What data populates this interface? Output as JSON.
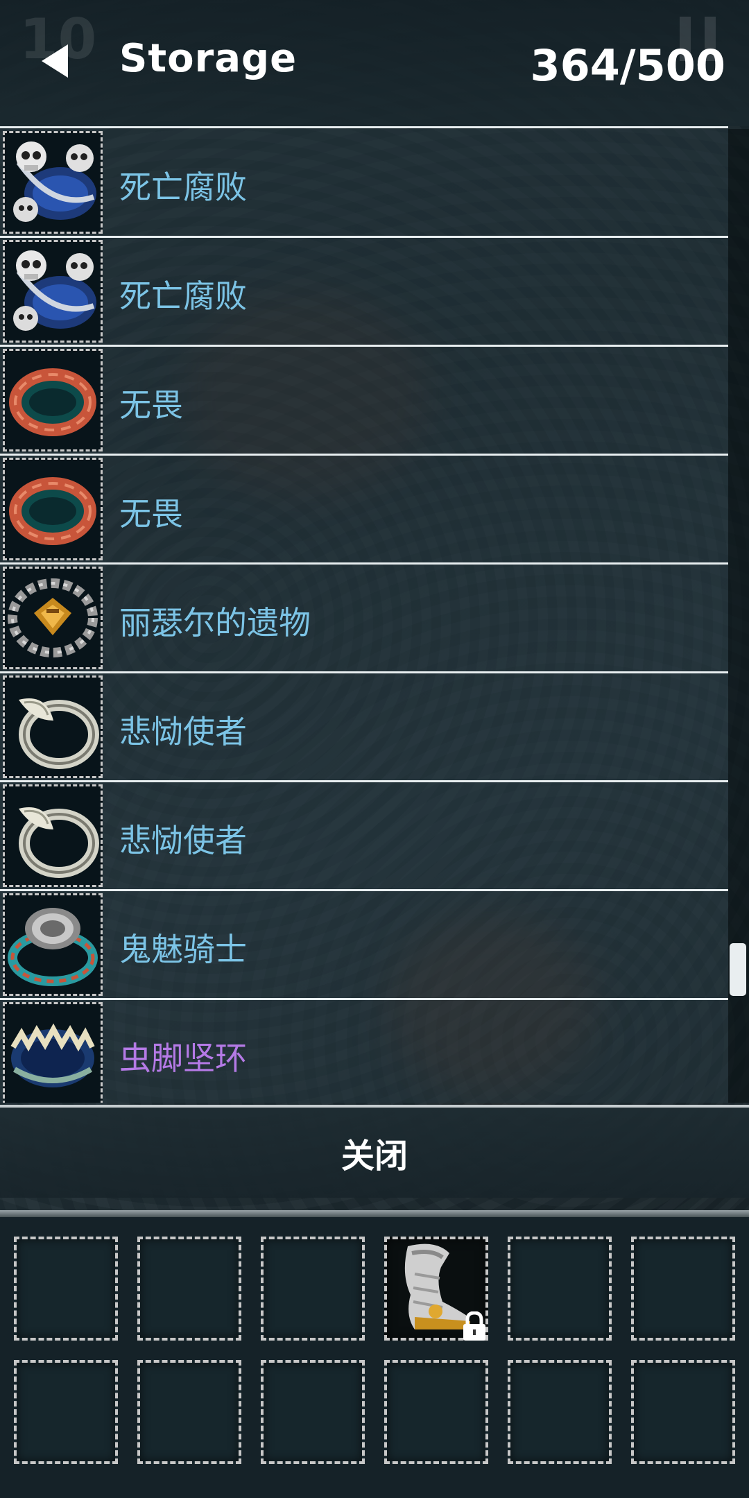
{
  "header": {
    "title": "Storage",
    "count": "364/500",
    "hud_level": "10"
  },
  "items": [
    {
      "name": "死亡腐败",
      "icon": "skull-amulet-icon",
      "rarity": "magic"
    },
    {
      "name": "死亡腐败",
      "icon": "skull-amulet-icon",
      "rarity": "magic"
    },
    {
      "name": "无畏",
      "icon": "red-ring-icon",
      "rarity": "magic"
    },
    {
      "name": "无畏",
      "icon": "red-ring-icon",
      "rarity": "magic"
    },
    {
      "name": "丽瑟尔的遗物",
      "icon": "chain-amulet-icon",
      "rarity": "magic"
    },
    {
      "name": "悲恸使者",
      "icon": "horn-ring-icon",
      "rarity": "magic"
    },
    {
      "name": "悲恸使者",
      "icon": "horn-ring-icon",
      "rarity": "magic"
    },
    {
      "name": "鬼魅骑士",
      "icon": "signet-ring-icon",
      "rarity": "magic"
    },
    {
      "name": "虫脚坚环",
      "icon": "fang-ring-icon",
      "rarity": "rare"
    }
  ],
  "close_button": "关闭",
  "bag": {
    "rows": 2,
    "cols": 6,
    "filled_slot": {
      "index": 3,
      "icon": "boots-icon",
      "locked": true
    }
  },
  "colors": {
    "magic": "#7cc4e6",
    "rare": "#b57ae6",
    "separator": "#e8eef0"
  }
}
